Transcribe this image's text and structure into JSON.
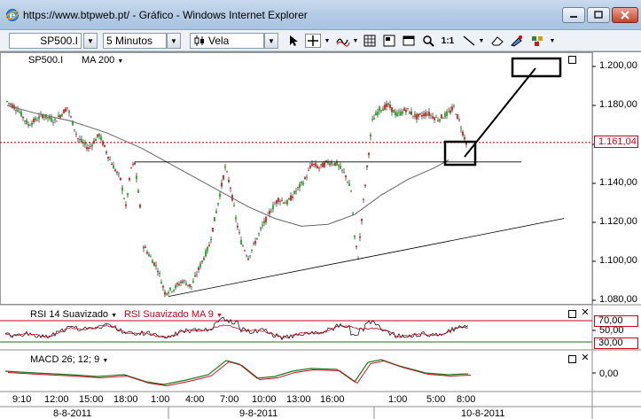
{
  "window": {
    "title": "https://www.btpweb.pt/ - Gráfico - Windows Internet Explorer"
  },
  "toolbar": {
    "symbol": "SP500.I",
    "interval": "5 Minutos",
    "chart_style": "Vela",
    "icons": [
      "pointer-icon",
      "crosshair-icon",
      "indicator-icon",
      "grid-icon",
      "template-icon",
      "zoom-icon",
      "fit-icon",
      "trendline-icon",
      "eraser-icon",
      "draw-tools-icon",
      "settings-icon"
    ],
    "fit_label": "1:1"
  },
  "price_panel": {
    "symbol_label": "SP500.I",
    "indicator_label": "MA 200",
    "y_ticks": [
      "1.200,00",
      "1.180,00",
      "1.160,00",
      "1.140,00",
      "1.120,00",
      "1.100,00",
      "1.080,00"
    ],
    "last_price": "1.161,04",
    "colors": {
      "up": "#00a000",
      "down": "#d00000",
      "ma": "#666666",
      "last_price": "#d0021b"
    }
  },
  "rsi_panel": {
    "label": "RSI 14 Suavizado",
    "ma_label": "RSI Suavizado MA 9",
    "y_ticks": [
      "70,00",
      "50,00",
      "30,00"
    ]
  },
  "macd_panel": {
    "label": "MACD 26; 12; 9",
    "y_ticks": [
      "0,00"
    ]
  },
  "x_axis": {
    "time_labels": [
      "9:10",
      "12:00",
      "15:00",
      "18:00",
      "1:00",
      "4:00",
      "7:00",
      "10:00",
      "13:00",
      "16:00",
      "1:00",
      "5:00",
      "8:00"
    ],
    "date_labels": [
      "8-8-2011",
      "9-8-2011",
      "10-8-2011"
    ]
  }
}
